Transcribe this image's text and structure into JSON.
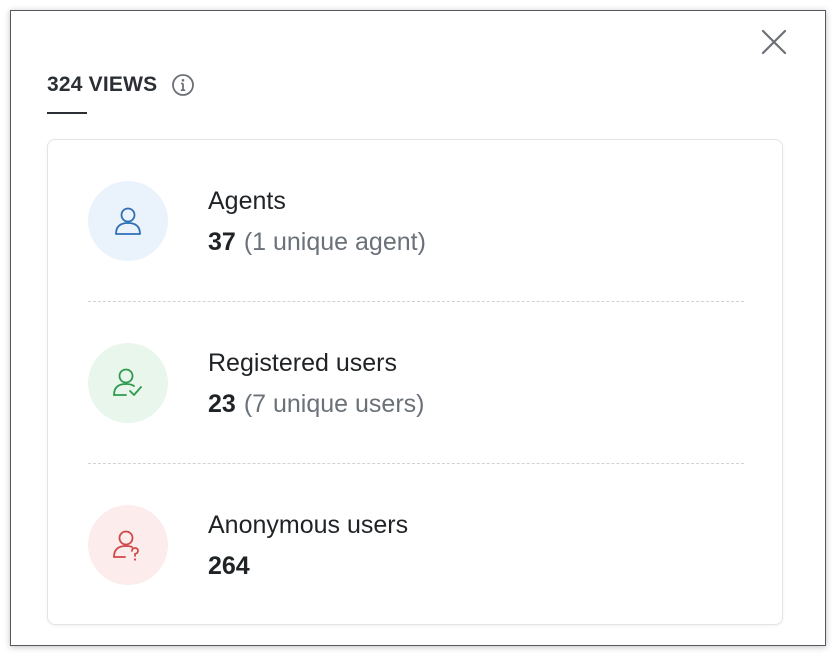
{
  "header": {
    "views_title": "324 VIEWS",
    "info_icon": "info-icon",
    "close_icon": "close-icon"
  },
  "rows": [
    {
      "icon": "user-icon",
      "label": "Agents",
      "count": "37",
      "unique": "(1 unique agent)",
      "accent": "#2f6fb5",
      "bg": "#eaf3fc"
    },
    {
      "icon": "user-check-icon",
      "label": "Registered users",
      "count": "23",
      "unique": "(7 unique users)",
      "accent": "#2e9b4e",
      "bg": "#e9f6ec"
    },
    {
      "icon": "user-question-icon",
      "label": "Anonymous users",
      "count": "264",
      "unique": "",
      "accent": "#d04848",
      "bg": "#fcecec"
    }
  ]
}
